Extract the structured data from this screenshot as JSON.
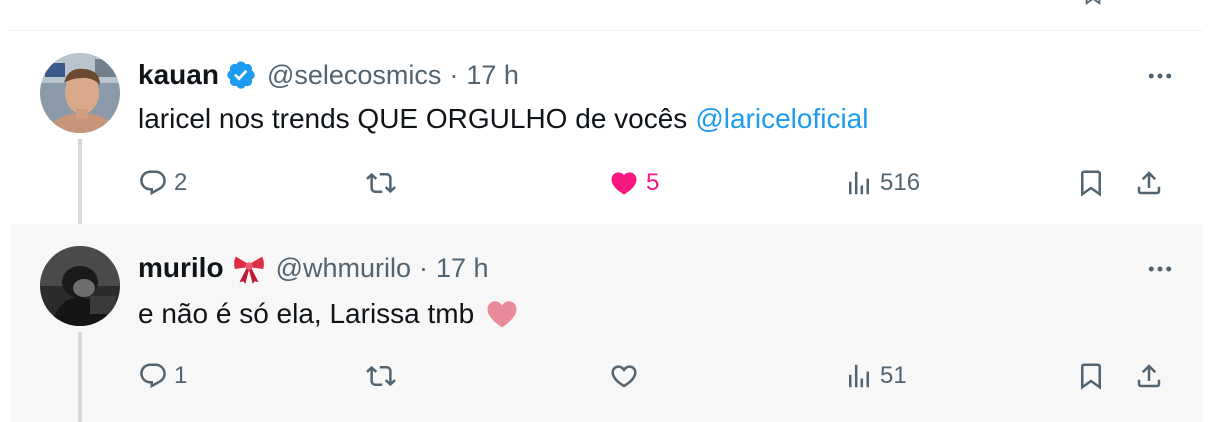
{
  "tweets": [
    {
      "display_name": "kauan",
      "verified": true,
      "handle": "@selecosmics",
      "separator": "·",
      "time": "17 h",
      "text": "laricel nos trends QUE ORGULHO de vocês",
      "mention": "@lariceloficial",
      "reply_count": "2",
      "retweet_count": "",
      "like_count": "5",
      "liked": true,
      "view_count": "516"
    },
    {
      "display_name": "murilo",
      "emoji_badge": "ribbon-bow",
      "handle": "@whmurilo",
      "separator": "·",
      "time": "17 h",
      "text": "e não é só ela, Larissa tmb",
      "trailing_emoji": "pink-heart",
      "reply_count": "1",
      "retweet_count": "",
      "like_count": "",
      "liked": false,
      "view_count": "51"
    }
  ],
  "colors": {
    "text_primary": "#0f1419",
    "text_secondary": "#536471",
    "accent_blue": "#1d9bf0",
    "like_pink": "#f91880",
    "thread_line": "#cfd9de",
    "highlight_bg": "#f7f7f7"
  },
  "icons": {
    "reply": "reply-bubble-icon",
    "retweet": "retweet-icon",
    "like": "heart-icon",
    "views": "analytics-bars-icon",
    "bookmark": "bookmark-icon",
    "share": "share-upload-icon",
    "more": "more-dots-icon",
    "verified": "verified-badge-icon"
  }
}
